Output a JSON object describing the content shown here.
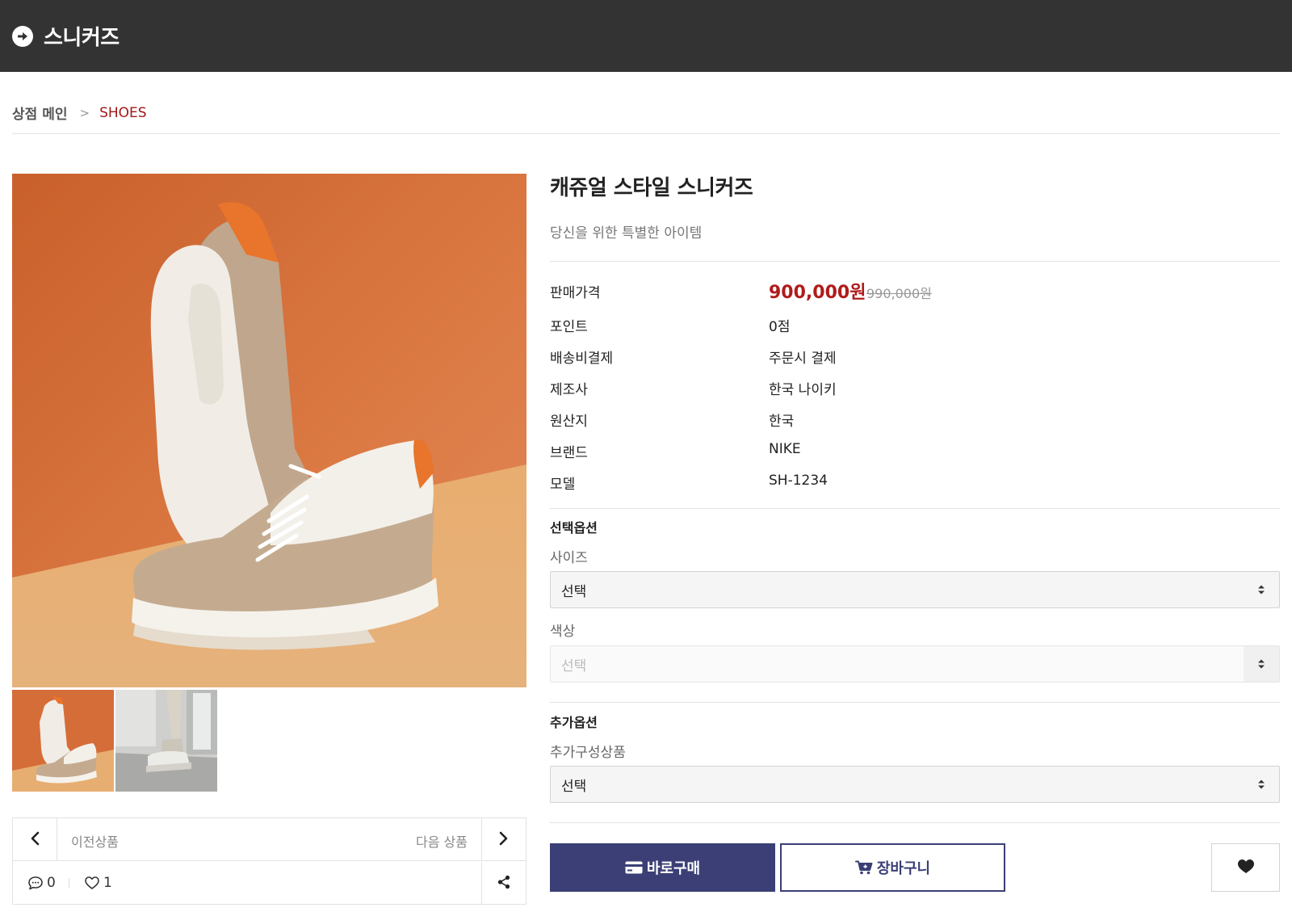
{
  "header": {
    "title": "스니커즈",
    "icon": "arrow-circle-right-icon"
  },
  "breadcrumb": {
    "home": "상점 메인",
    "separator": ">",
    "current": "SHOES"
  },
  "product": {
    "name": "캐쥬얼 스타일 스니커즈",
    "description": "당신을 위한 특별한 아이템",
    "price_label": "판매가격",
    "sale_price": "900,000원",
    "original_price": "990,000원",
    "info": [
      {
        "label": "포인트",
        "value": "0점"
      },
      {
        "label": "배송비결제",
        "value": "주문시 결제"
      },
      {
        "label": "제조사",
        "value": "한국 나이키"
      },
      {
        "label": "원산지",
        "value": "한국"
      },
      {
        "label": "브랜드",
        "value": "NIKE"
      },
      {
        "label": "모델",
        "value": "SH-1234"
      }
    ]
  },
  "options": {
    "title": "선택옵션",
    "size": {
      "label": "사이즈",
      "selected": "선택"
    },
    "color": {
      "label": "색상",
      "selected": "선택"
    }
  },
  "extra_options": {
    "title": "추가옵션",
    "component": {
      "label": "추가구성상품",
      "selected": "선택"
    }
  },
  "actions": {
    "buy_now": "바로구매",
    "cart": "장바구니"
  },
  "navigation": {
    "prev": "이전상품",
    "next": "다음 상품"
  },
  "stats": {
    "comments": "0",
    "likes": "1"
  },
  "colors": {
    "topbar": "#333333",
    "accent_red": "#b01b1b",
    "brand_navy": "#3b3f75",
    "background_orange": "#d9733e"
  }
}
